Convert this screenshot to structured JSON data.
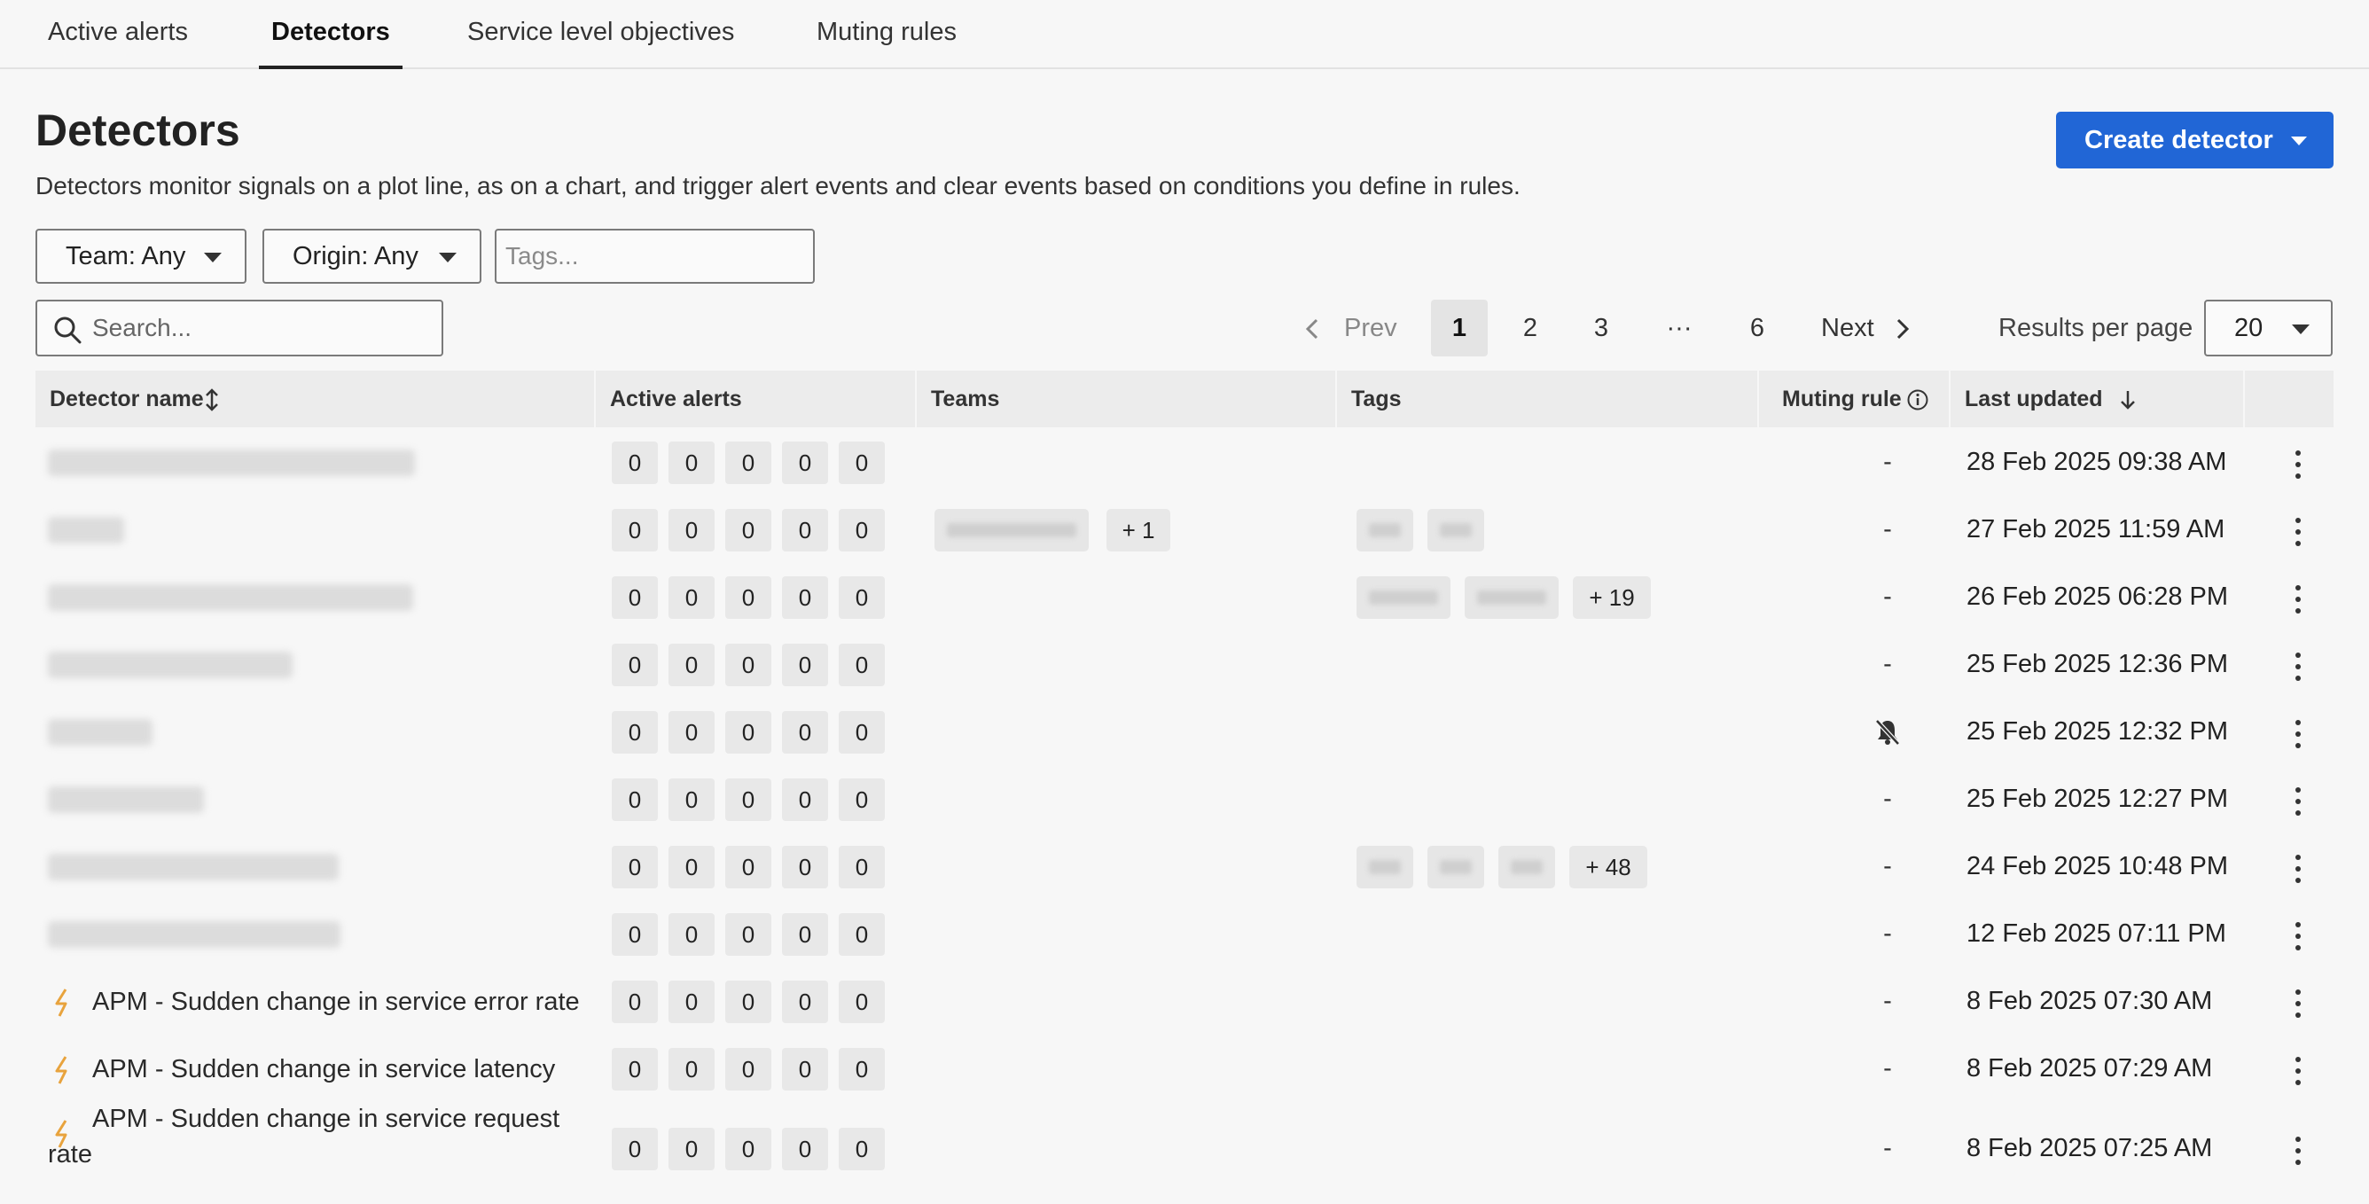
{
  "tabs": [
    {
      "label": "Active alerts"
    },
    {
      "label": "Detectors"
    },
    {
      "label": "Service level objectives"
    },
    {
      "label": "Muting rules"
    }
  ],
  "header": {
    "title": "Detectors",
    "description": "Detectors monitor signals on a plot line, as on a chart, and trigger alert events and clear events based on conditions you define in rules.",
    "create_label": "Create detector",
    "accent_color": "#2166d6"
  },
  "filters": {
    "team": "Team: Any",
    "origin": "Origin: Any",
    "tags_placeholder": "Tags...",
    "search_placeholder": "Search..."
  },
  "pagination": {
    "prev": "Prev",
    "pages": [
      "1",
      "2",
      "3",
      "···",
      "6"
    ],
    "next": "Next",
    "results_per_page_label": "Results per page",
    "results_per_page": "20"
  },
  "table": {
    "columns": {
      "name": "Detector name",
      "active_alerts": "Active alerts",
      "teams": "Teams",
      "tags": "Tags",
      "muting_rule": "Muting rule",
      "last_updated": "Last updated"
    },
    "rows": [
      {
        "name": "",
        "alerts": [
          "0",
          "0",
          "0",
          "0",
          "0"
        ],
        "team_more": "",
        "tags_more": "",
        "muting": "-",
        "muted": false,
        "updated": "28 Feb 2025 09:38 AM"
      },
      {
        "name": "",
        "alerts": [
          "0",
          "0",
          "0",
          "0",
          "0"
        ],
        "team_more": "+ 1",
        "tags_more": "",
        "muting": "-",
        "muted": false,
        "updated": "27 Feb 2025 11:59 AM"
      },
      {
        "name": "",
        "alerts": [
          "0",
          "0",
          "0",
          "0",
          "0"
        ],
        "team_more": "",
        "tags_more": "+ 19",
        "muting": "-",
        "muted": false,
        "updated": "26 Feb 2025 06:28 PM"
      },
      {
        "name": "",
        "alerts": [
          "0",
          "0",
          "0",
          "0",
          "0"
        ],
        "team_more": "",
        "tags_more": "",
        "muting": "-",
        "muted": false,
        "updated": "25 Feb 2025 12:36 PM"
      },
      {
        "name": "",
        "alerts": [
          "0",
          "0",
          "0",
          "0",
          "0"
        ],
        "team_more": "",
        "tags_more": "",
        "muting": "",
        "muted": true,
        "updated": "25 Feb 2025 12:32 PM"
      },
      {
        "name": "",
        "alerts": [
          "0",
          "0",
          "0",
          "0",
          "0"
        ],
        "team_more": "",
        "tags_more": "",
        "muting": "-",
        "muted": false,
        "updated": "25 Feb 2025 12:27 PM"
      },
      {
        "name": "",
        "alerts": [
          "0",
          "0",
          "0",
          "0",
          "0"
        ],
        "team_more": "",
        "tags_more": "+ 48",
        "muting": "-",
        "muted": false,
        "updated": "24 Feb 2025 10:48 PM"
      },
      {
        "name": "",
        "alerts": [
          "0",
          "0",
          "0",
          "0",
          "0"
        ],
        "team_more": "",
        "tags_more": "",
        "muting": "-",
        "muted": false,
        "updated": "12 Feb 2025 07:11 PM"
      },
      {
        "name": "APM - Sudden change in service error rate",
        "alerts": [
          "0",
          "0",
          "0",
          "0",
          "0"
        ],
        "team_more": "",
        "tags_more": "",
        "muting": "-",
        "muted": false,
        "updated": "8 Feb 2025 07:30 AM"
      },
      {
        "name": "APM - Sudden change in service latency",
        "alerts": [
          "0",
          "0",
          "0",
          "0",
          "0"
        ],
        "team_more": "",
        "tags_more": "",
        "muting": "-",
        "muted": false,
        "updated": "8 Feb 2025 07:29 AM"
      },
      {
        "name": "APM - Sudden change in service request",
        "name_line2": "rate",
        "alerts": [
          "0",
          "0",
          "0",
          "0",
          "0"
        ],
        "team_more": "",
        "tags_more": "",
        "muting": "-",
        "muted": false,
        "updated": "8 Feb 2025 07:25 AM"
      }
    ]
  },
  "icons": {
    "search": "search-icon",
    "prev": "chevron-left-icon",
    "next": "chevron-right-icon",
    "sort": "sort-icon",
    "info": "info-icon",
    "sort_desc": "arrow-down-icon",
    "apm": "lightning-icon",
    "muted": "bell-slash-icon",
    "actions": "kebab-menu-icon"
  },
  "colors": {
    "bolt": "#e8a33d"
  }
}
